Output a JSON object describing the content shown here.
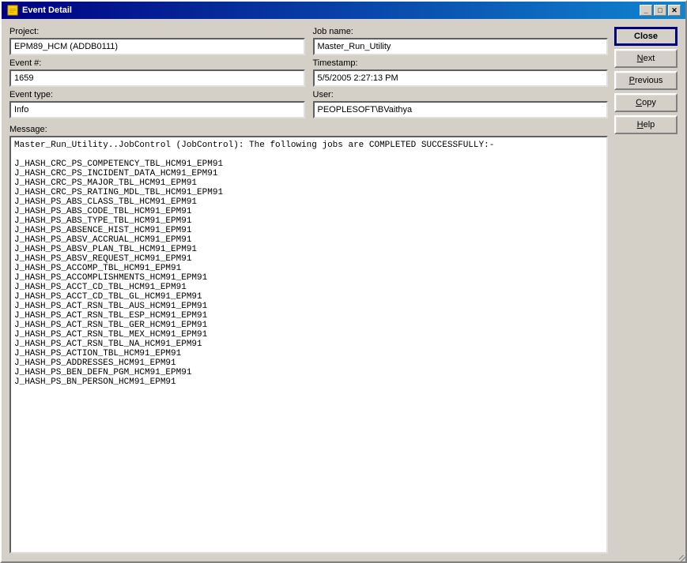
{
  "window": {
    "title": "Event Detail",
    "title_icon": "⚙"
  },
  "title_controls": {
    "minimize": "_",
    "maximize": "□",
    "close": "✕"
  },
  "form": {
    "project_label": "Project:",
    "project_value": "EPM89_HCM (ADDB0111)",
    "job_name_label": "Job name:",
    "job_name_value": "Master_Run_Utility",
    "event_num_label": "Event #:",
    "event_num_value": "1659",
    "timestamp_label": "Timestamp:",
    "timestamp_value": "5/5/2005 2:27:13 PM",
    "event_type_label": "Event type:",
    "event_type_value": "Info",
    "user_label": "User:",
    "user_value": "PEOPLESOFT\\BVaithya",
    "message_label": "Message:"
  },
  "message_content": "Master_Run_Utility..JobControl (JobControl): The following jobs are COMPLETED SUCCESSFULLY:-\n\nJ_HASH_CRC_PS_COMPETENCY_TBL_HCM91_EPM91\nJ_HASH_CRC_PS_INCIDENT_DATA_HCM91_EPM91\nJ_HASH_CRC_PS_MAJOR_TBL_HCM91_EPM91\nJ_HASH_CRC_PS_RATING_MDL_TBL_HCM91_EPM91\nJ_HASH_PS_ABS_CLASS_TBL_HCM91_EPM91\nJ_HASH_PS_ABS_CODE_TBL_HCM91_EPM91\nJ_HASH_PS_ABS_TYPE_TBL_HCM91_EPM91\nJ_HASH_PS_ABSENCE_HIST_HCM91_EPM91\nJ_HASH_PS_ABSV_ACCRUAL_HCM91_EPM91\nJ_HASH_PS_ABSV_PLAN_TBL_HCM91_EPM91\nJ_HASH_PS_ABSV_REQUEST_HCM91_EPM91\nJ_HASH_PS_ACCOMP_TBL_HCM91_EPM91\nJ_HASH_PS_ACCOMPLISHMENTS_HCM91_EPM91\nJ_HASH_PS_ACCT_CD_TBL_HCM91_EPM91\nJ_HASH_PS_ACCT_CD_TBL_GL_HCM91_EPM91\nJ_HASH_PS_ACT_RSN_TBL_AUS_HCM91_EPM91\nJ_HASH_PS_ACT_RSN_TBL_ESP_HCM91_EPM91\nJ_HASH_PS_ACT_RSN_TBL_GER_HCM91_EPM91\nJ_HASH_PS_ACT_RSN_TBL_MEX_HCM91_EPM91\nJ_HASH_PS_ACT_RSN_TBL_NA_HCM91_EPM91\nJ_HASH_PS_ACTION_TBL_HCM91_EPM91\nJ_HASH_PS_ADDRESSES_HCM91_EPM91\nJ_HASH_PS_BEN_DEFN_PGM_HCM91_EPM91\nJ_HASH_PS_BN_PERSON_HCM91_EPM91",
  "buttons": {
    "close": "Close",
    "next": "Next",
    "previous": "Previous",
    "copy": "Copy",
    "help": "Help"
  }
}
